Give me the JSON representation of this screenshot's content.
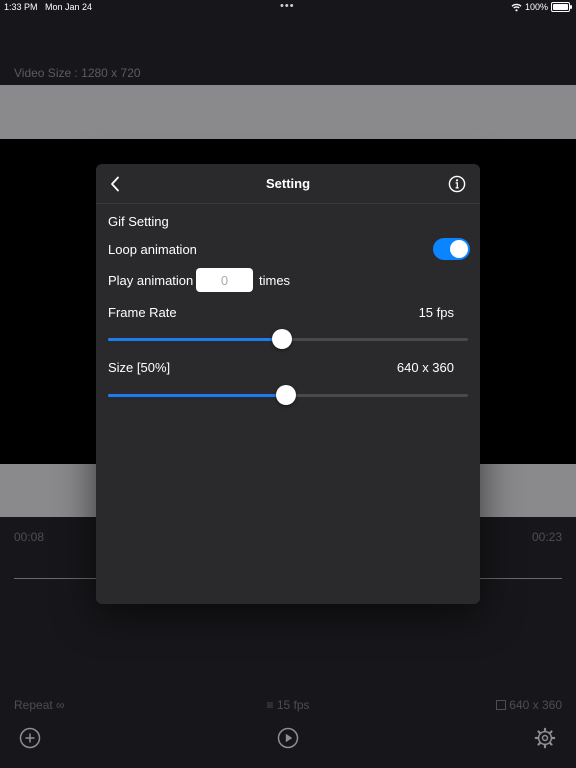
{
  "status": {
    "time": "1:33 PM",
    "date": "Mon Jan 24",
    "battery": "100%",
    "battery_level": 1.0
  },
  "editor": {
    "video_size": "Video Size : 1280 x 720",
    "time_start": "00:08",
    "time_end": "00:23",
    "repeat": "Repeat ∞",
    "fps": "≡ 15 fps",
    "dimensions": "640 x 360"
  },
  "toolbar": {
    "add_icon": "plus-circle-icon",
    "play_icon": "play-circle-icon",
    "settings_icon": "gear-icon"
  },
  "dialog": {
    "title": "Setting",
    "section": "Gif Setting",
    "loop_label": "Loop animation",
    "loop_enabled": true,
    "play_label": "Play animation",
    "play_placeholder": "0",
    "times_label": "times",
    "frame_rate_label": "Frame Rate",
    "frame_rate_value": "15 fps",
    "frame_rate_fraction": 0.483,
    "size_label": "Size [50%]",
    "size_value": "640 x 360",
    "size_fraction": 0.495
  },
  "colors": {
    "accent": "#0a84ff",
    "background": "#17171b",
    "dialog": "#2a2a2d"
  }
}
